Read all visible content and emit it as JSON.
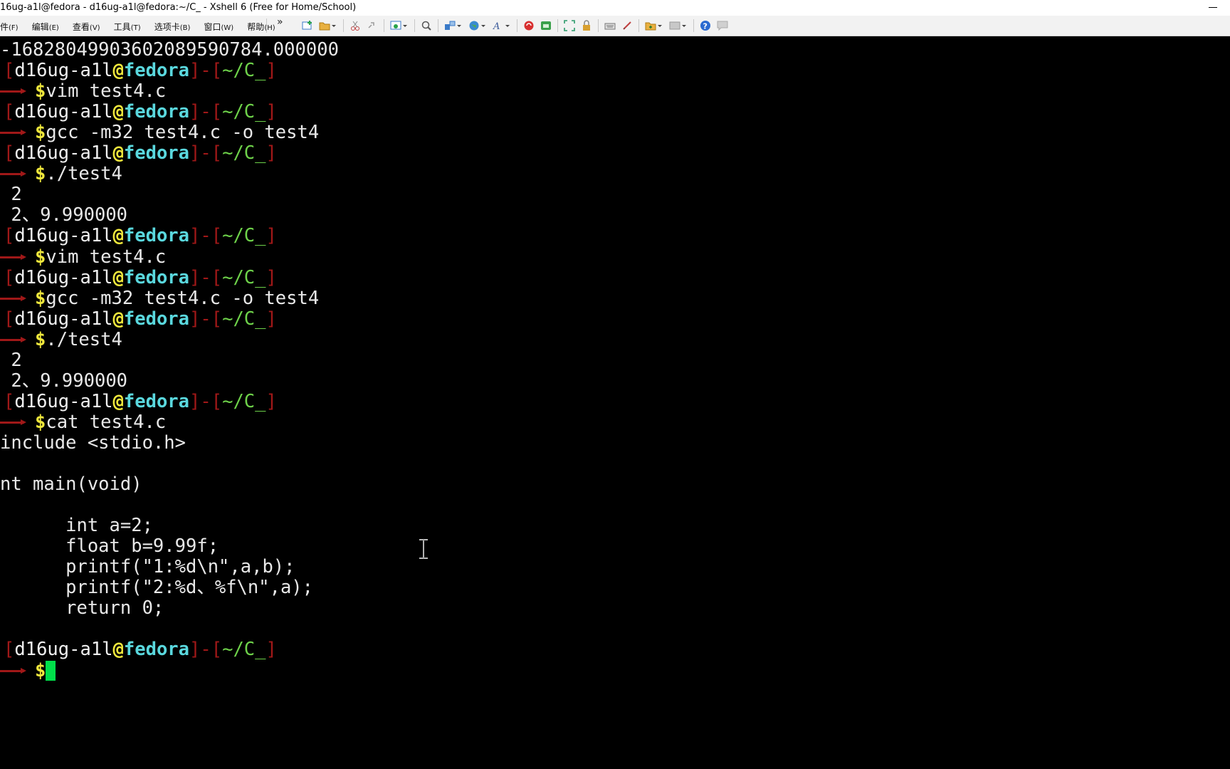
{
  "window": {
    "title": "16ug-a1l@fedora - d16ug-a1l@fedora:~/C_ - Xshell 6 (Free for Home/School)",
    "minimize": "minimize-button"
  },
  "menubar": [
    {
      "label": "件",
      "accel": "(F)"
    },
    {
      "label": "编辑",
      "accel": "(E)"
    },
    {
      "label": "查看",
      "accel": "(V)"
    },
    {
      "label": "工具",
      "accel": "(T)"
    },
    {
      "label": "选项卡",
      "accel": "(B)"
    },
    {
      "label": "窗口",
      "accel": "(W)"
    },
    {
      "label": "帮助",
      "accel": "(H)"
    }
  ],
  "toolbar": {
    "overflow": "»",
    "icons": [
      "new-session-icon",
      "open-folder-icon",
      "cut-icon",
      "link-icon",
      "session-manager-icon",
      "search-icon",
      "layout-icon",
      "globe-icon",
      "font-icon",
      "xftp-icon",
      "xmanager-icon",
      "fullscreen-icon",
      "lock-icon",
      "keyboard-icon",
      "script-icon",
      "transfer-icon",
      "options-icon",
      "help-icon",
      "chat-icon"
    ]
  },
  "terminal": {
    "prompt": {
      "open": "[",
      "user": "d16ug-a1l",
      "at": "@",
      "host": "fedora",
      "close": "]",
      "sep": "-",
      "path_open": "[",
      "path": "~/C_",
      "path_close": "]",
      "dollar": "$"
    },
    "lines": [
      {
        "kind": "output",
        "text": "-16828049903602089590784.000000"
      },
      {
        "kind": "prompt"
      },
      {
        "kind": "cmd",
        "text": "vim test4.c"
      },
      {
        "kind": "prompt"
      },
      {
        "kind": "cmd",
        "text": "gcc -m32 test4.c -o test4"
      },
      {
        "kind": "prompt"
      },
      {
        "kind": "cmd",
        "text": "./test4"
      },
      {
        "kind": "output",
        "text": " 2"
      },
      {
        "kind": "output",
        "text": " 2、9.990000"
      },
      {
        "kind": "prompt"
      },
      {
        "kind": "cmd",
        "text": "vim test4.c"
      },
      {
        "kind": "prompt"
      },
      {
        "kind": "cmd",
        "text": "gcc -m32 test4.c -o test4"
      },
      {
        "kind": "prompt"
      },
      {
        "kind": "cmd",
        "text": "./test4"
      },
      {
        "kind": "output",
        "text": " 2"
      },
      {
        "kind": "output",
        "text": " 2、9.990000"
      },
      {
        "kind": "prompt"
      },
      {
        "kind": "cmd",
        "text": "cat test4.c"
      },
      {
        "kind": "output",
        "text": "include <stdio.h>"
      },
      {
        "kind": "output",
        "text": ""
      },
      {
        "kind": "output",
        "text": "nt main(void)"
      },
      {
        "kind": "output",
        "text": ""
      },
      {
        "kind": "output",
        "text": "      int a=2;"
      },
      {
        "kind": "output",
        "text": "      float b=9.99f;"
      },
      {
        "kind": "output",
        "text": "      printf(\"1:%d\\n\",a,b);"
      },
      {
        "kind": "output",
        "text": "      printf(\"2:%d、%f\\n\",a);"
      },
      {
        "kind": "output",
        "text": "      return 0;"
      },
      {
        "kind": "output",
        "text": ""
      },
      {
        "kind": "prompt"
      },
      {
        "kind": "cmd_cursor",
        "text": ""
      }
    ]
  },
  "colors": {
    "background": "#000000",
    "prompt_bracket": "#a01818",
    "user": "#f0f0f0",
    "at": "#f0e83c",
    "host": "#5ad8de",
    "path": "#6ed24a",
    "dollar": "#f0e83c",
    "cursor": "#00e04a"
  }
}
